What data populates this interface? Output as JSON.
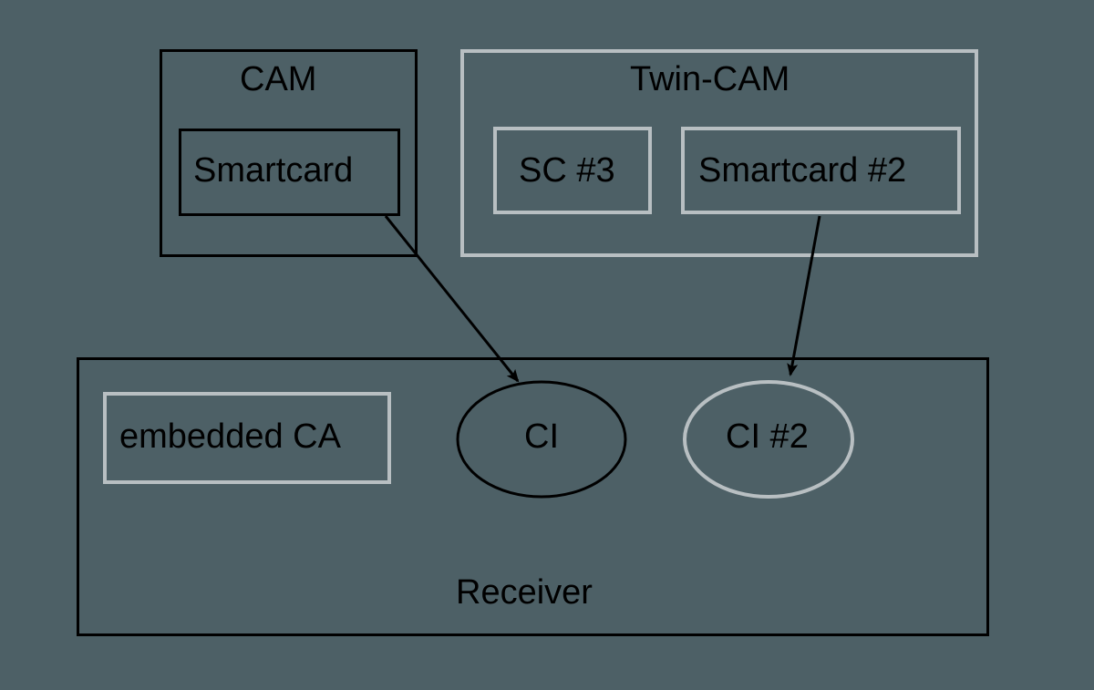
{
  "diagram": {
    "cam": {
      "title": "CAM",
      "smartcard": "Smartcard"
    },
    "twin_cam": {
      "title": "Twin-CAM",
      "sc3": "SC #3",
      "sc2": "Smartcard #2"
    },
    "receiver": {
      "title": "Receiver",
      "embedded_ca": "embedded CA",
      "ci": "CI",
      "ci2": "CI #2"
    }
  }
}
